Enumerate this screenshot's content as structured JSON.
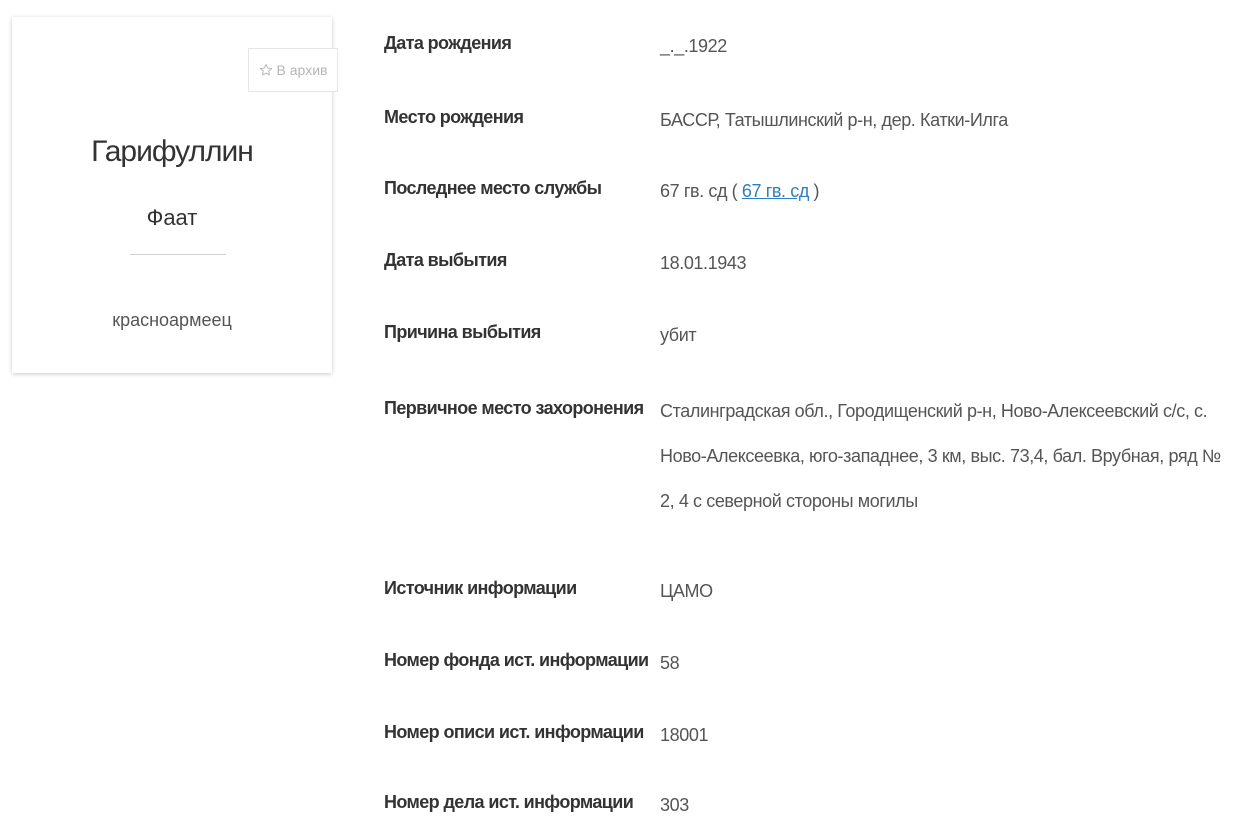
{
  "person": {
    "surname": "Гарифуллин",
    "first_name": "Фаат",
    "rank": "красноармеец",
    "archive_label": "В архив",
    "archive_icon": "star-outline-icon"
  },
  "details": [
    {
      "label": "Дата рождения",
      "value": "_._.1922"
    },
    {
      "label": "Место рождения",
      "value": "БАССР, Татышлинский р-н, дер. Катки-Илга"
    },
    {
      "label": "Последнее место службы",
      "value_prefix": "67 гв. сд (",
      "value_link": "67 гв. сд",
      "value_suffix": ")"
    },
    {
      "label": "Дата выбытия",
      "value": "18.01.1943"
    },
    {
      "label": "Причина выбытия",
      "value": "убит"
    },
    {
      "label": "Первичное место захоронения",
      "value": "Сталинградская обл., Городищенский р-н, Ново-Алексеевский с/с, с. Ново-Алексеевка, юго-западнее, 3 км, выс. 73,4, бал. Врубная, ряд № 2, 4 с северной стороны могилы"
    },
    {
      "label": "Источник информации",
      "value": "ЦАМО"
    },
    {
      "label": "Номер фонда ист. информации",
      "value": "58"
    },
    {
      "label": "Номер описи ист. информации",
      "value": "18001"
    },
    {
      "label": "Номер дела ист. информации",
      "value": "303"
    }
  ],
  "colors": {
    "link": "#2f7ec0",
    "label_text": "#333333",
    "value_text": "#555555"
  }
}
